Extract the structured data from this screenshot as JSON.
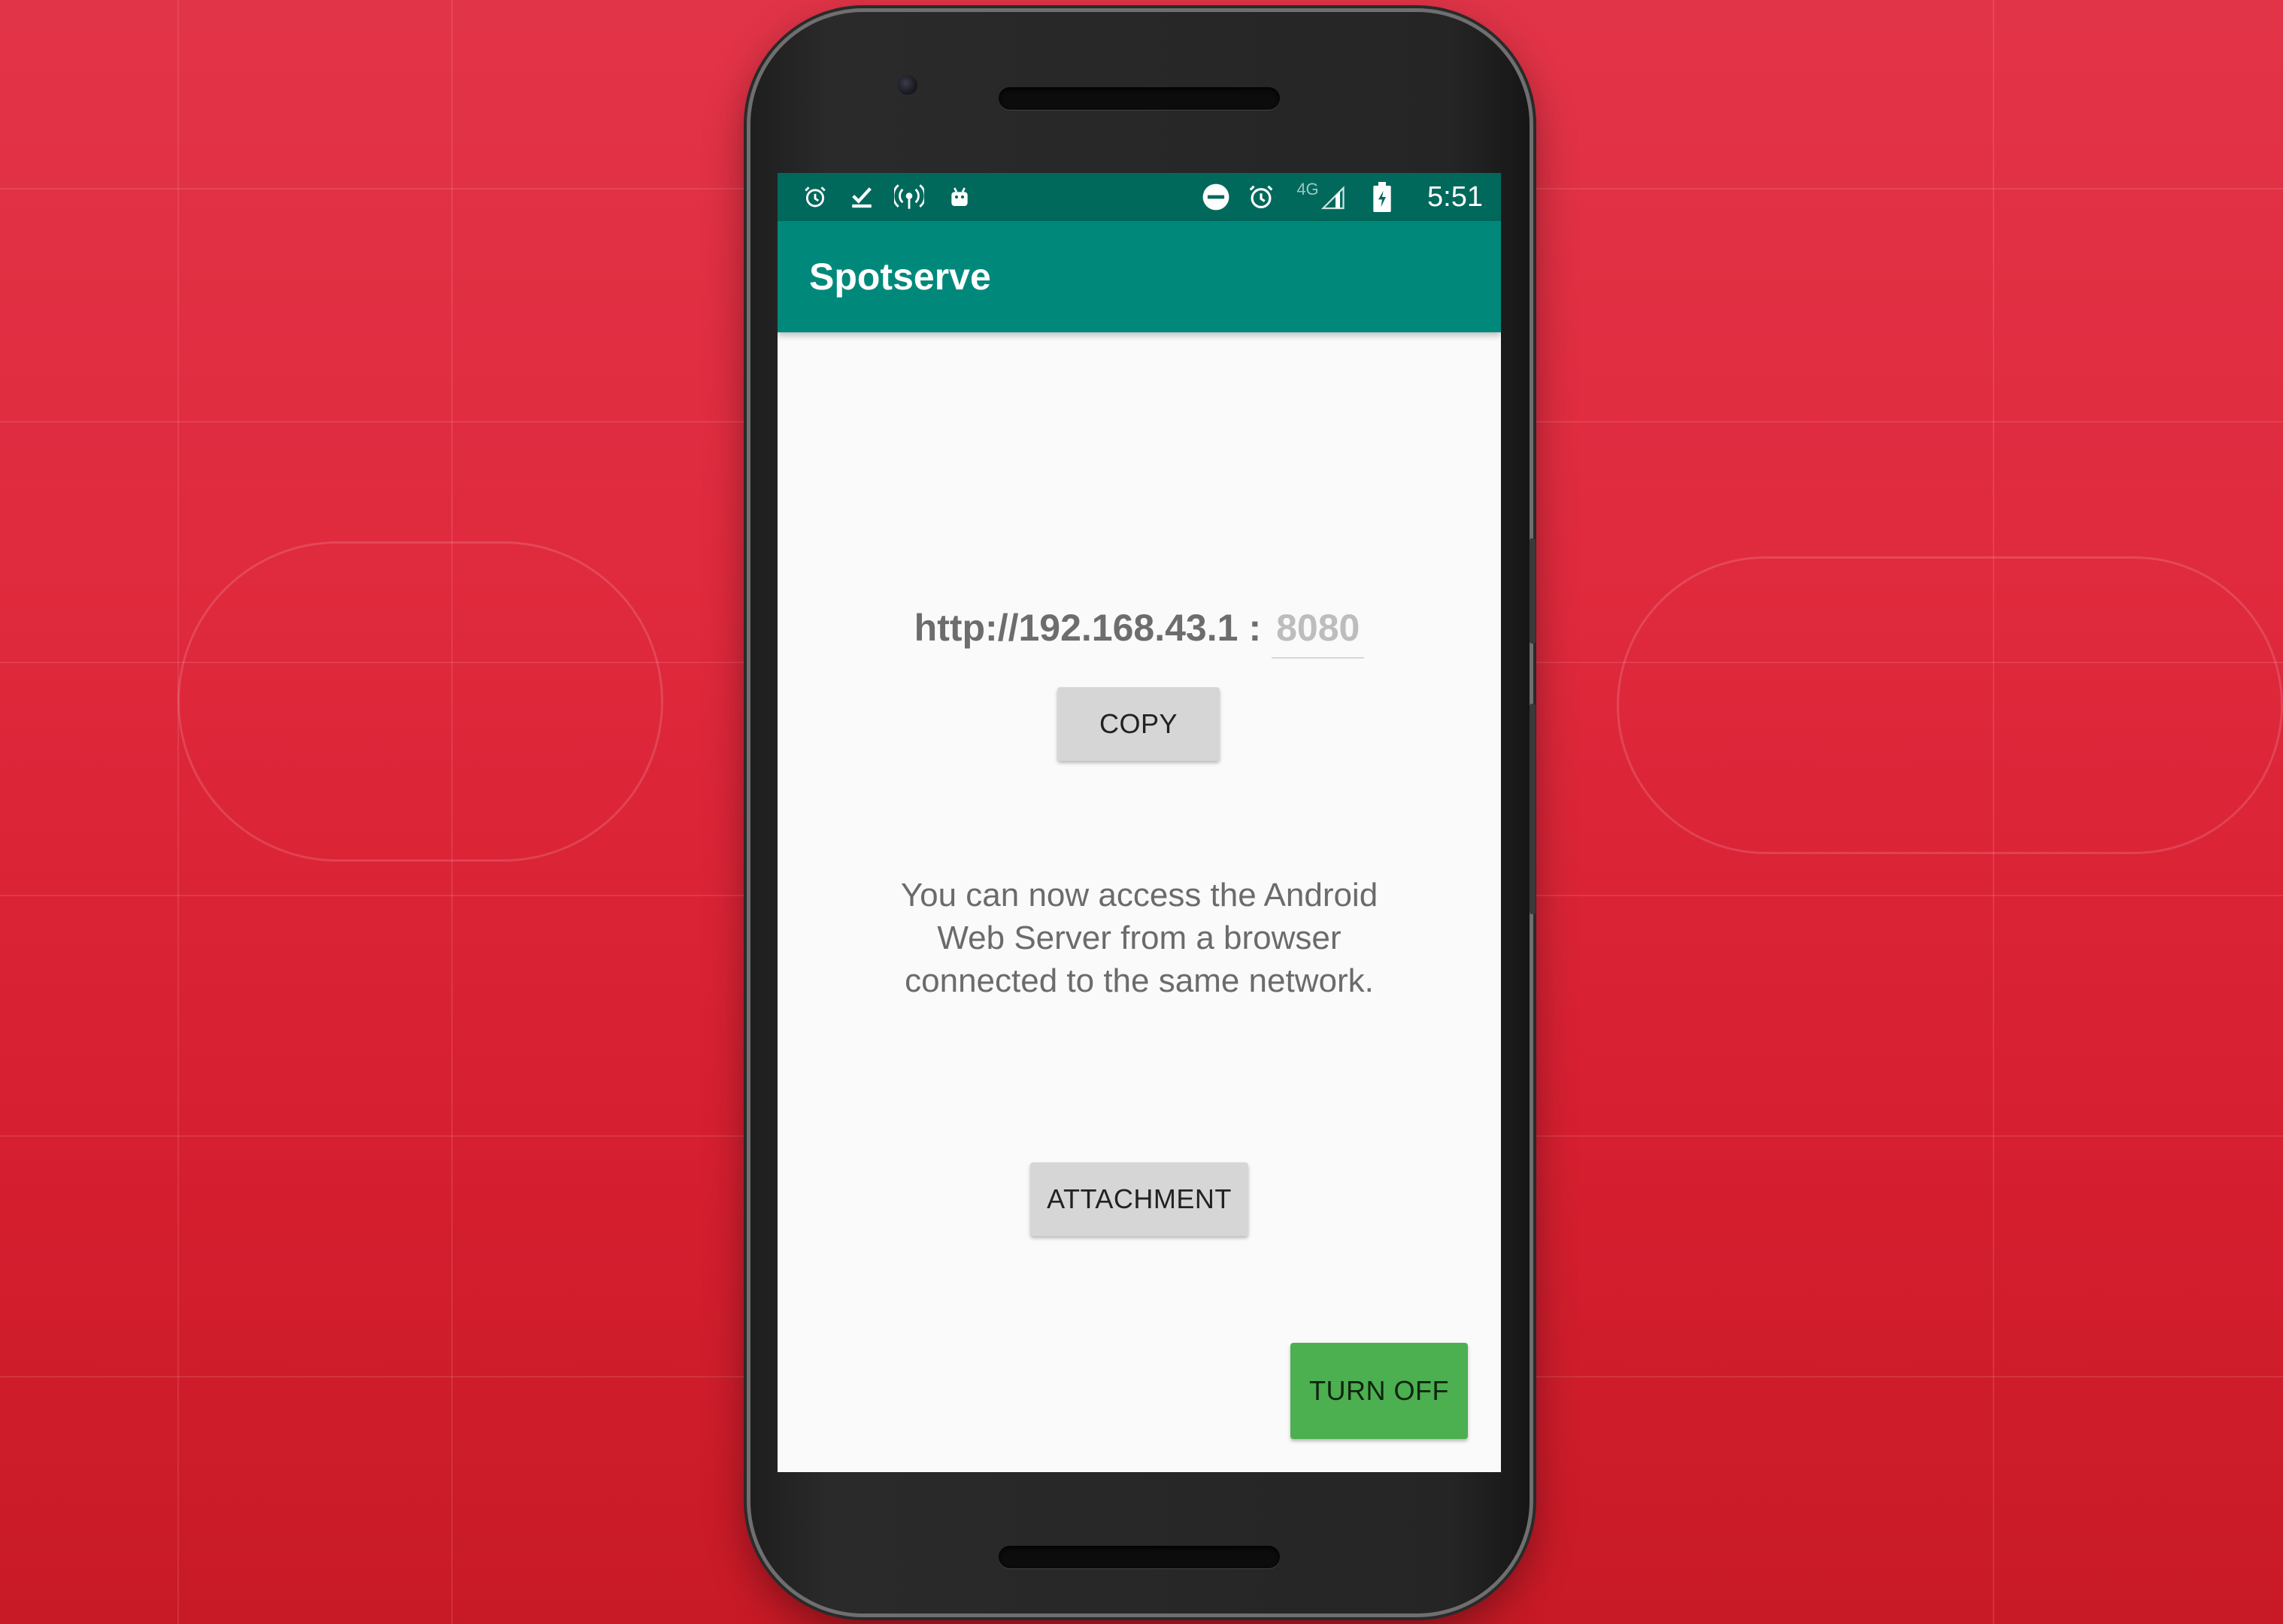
{
  "status_bar": {
    "left_icons": [
      "alarm-icon",
      "download-done-icon",
      "hotspot-icon",
      "android-icon"
    ],
    "right_icons": [
      "do-not-disturb-icon",
      "alarm-icon",
      "signal-4g-icon",
      "battery-charging-icon"
    ],
    "network_label": "4G",
    "time": "5:51"
  },
  "app": {
    "title": "Spotserve",
    "url": "http://192.168.43.1",
    "separator": ":",
    "port_hint": "8080",
    "copy_label": "COPY",
    "message": "You can now access the Android Web Server from a browser connected to the same network.",
    "attachment_label": "ATTACHMENT",
    "turn_off_label": "TURN OFF"
  },
  "colors": {
    "status_bar": "#00695c",
    "app_bar": "#00897b",
    "turn_off_button": "#4caf50",
    "background": "#e02a3d"
  }
}
